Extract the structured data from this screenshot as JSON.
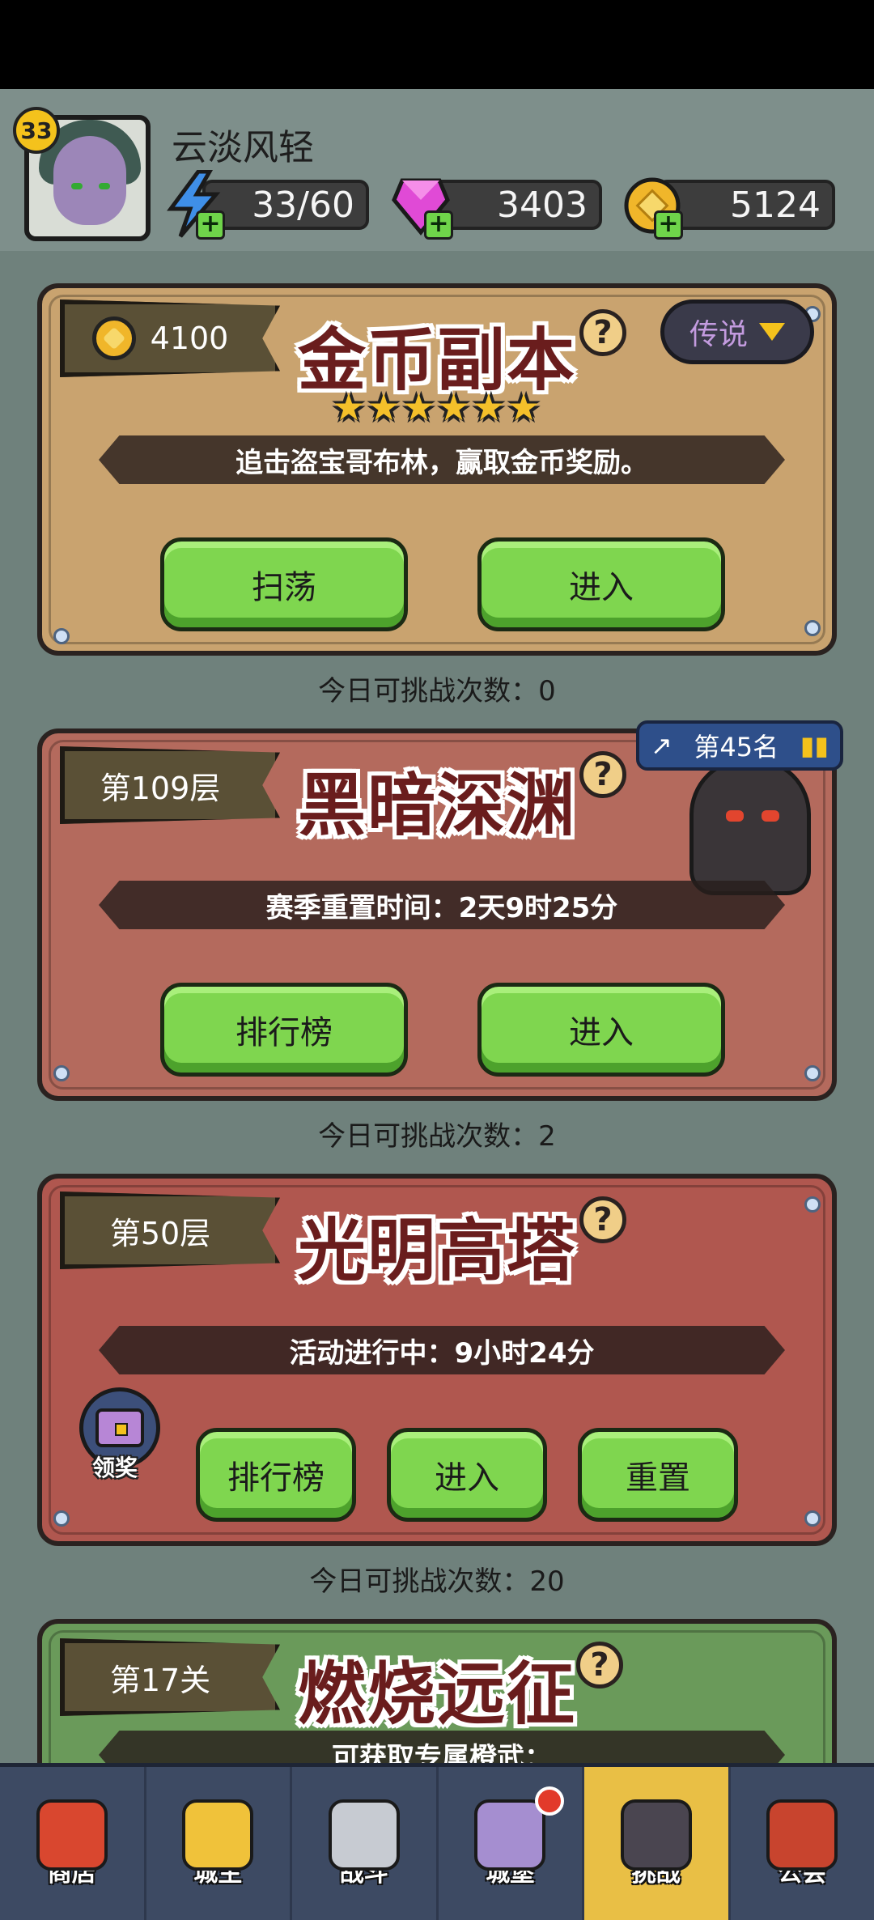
{
  "player": {
    "name": "云淡风轻",
    "level": "33",
    "energy": "33/60",
    "gems": "3403",
    "gold": "5124"
  },
  "cards": {
    "gold_dungeon": {
      "coin_reward": "4100",
      "title": "金币副本",
      "help": "?",
      "difficulty": "传说",
      "stars": "★★★★★★",
      "description": "追击盗宝哥布林，赢取金币奖励。",
      "btn_sweep": "扫荡",
      "btn_enter": "进入",
      "attempts": "今日可挑战次数：0"
    },
    "dark_abyss": {
      "floor": "第109层",
      "title": "黑暗深渊",
      "help": "?",
      "rank": "第45名",
      "description": "赛季重置时间：2天9时25分",
      "btn_rank": "排行榜",
      "btn_enter": "进入",
      "attempts": "今日可挑战次数：2"
    },
    "light_tower": {
      "floor": "第50层",
      "title": "光明高塔",
      "help": "?",
      "description": "活动进行中：9小时24分",
      "reward_label": "领奖",
      "btn_rank": "排行榜",
      "btn_enter": "进入",
      "btn_reset": "重置",
      "attempts": "今日可挑战次数：20"
    },
    "burning_expedition": {
      "stage": "第17关",
      "title": "燃烧远征",
      "help": "?",
      "description": "可获取专属橙武："
    }
  },
  "nav": [
    {
      "label": "商店",
      "icon": "shop-icon",
      "color": "#d9472f"
    },
    {
      "label": "城主",
      "icon": "crown-icon",
      "color": "#f0c23a"
    },
    {
      "label": "战斗",
      "icon": "swords-icon",
      "color": "#c7cbd2"
    },
    {
      "label": "城堡",
      "icon": "castle-icon",
      "color": "#a58ed0"
    },
    {
      "label": "挑战",
      "icon": "demon-helmet-icon",
      "color": "#4a4550"
    },
    {
      "label": "公会",
      "icon": "guild-banner-icon",
      "color": "#c8442e"
    }
  ],
  "colors": {
    "button_green": "#7fd64f",
    "title_red": "#6a1d1d",
    "nav_active": "#e9bf45"
  }
}
